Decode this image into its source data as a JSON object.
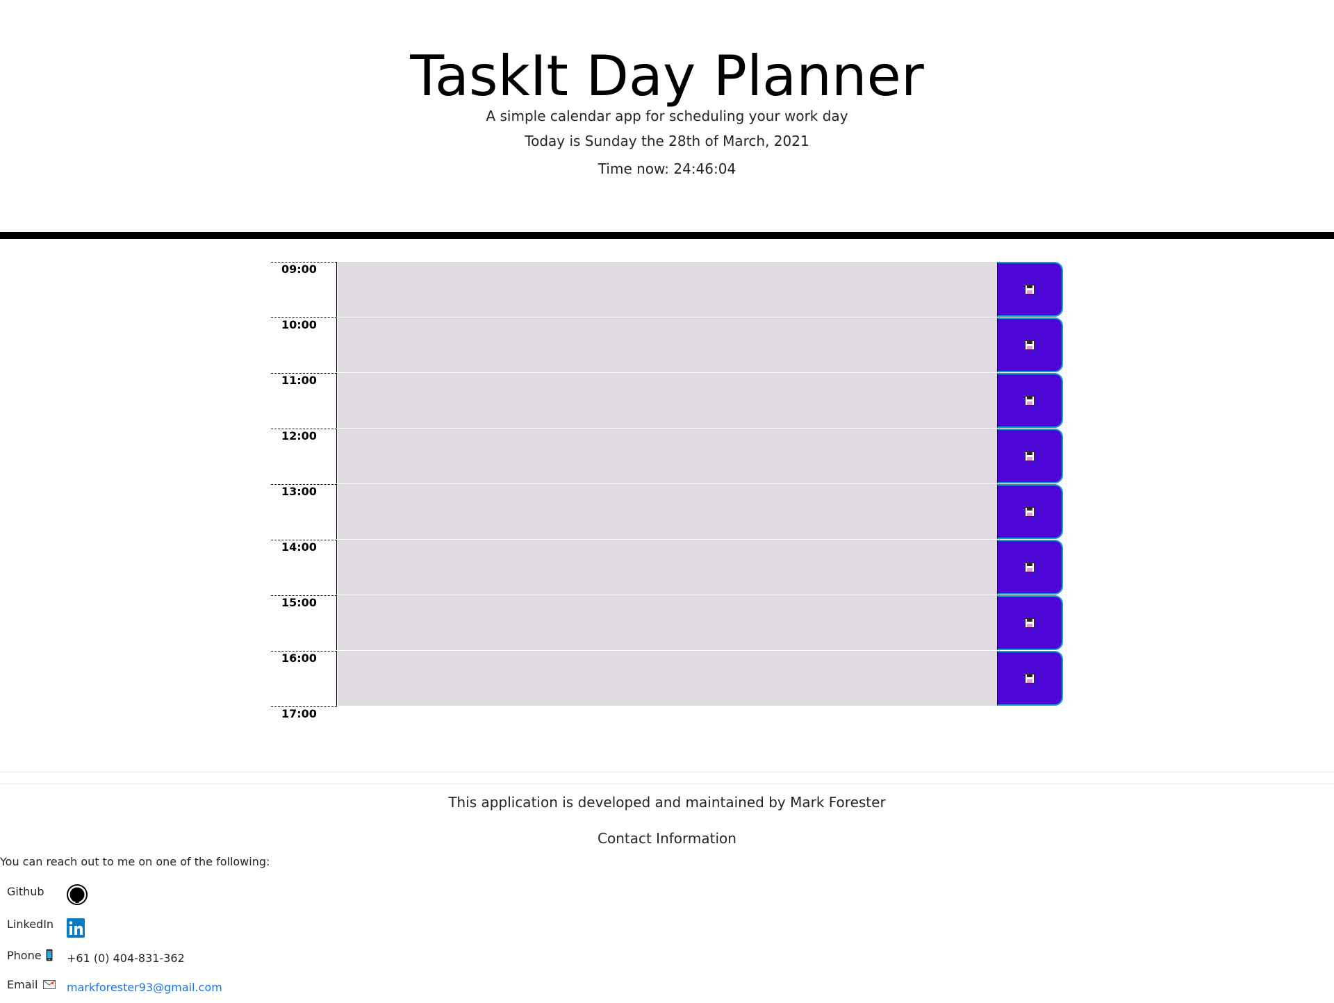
{
  "header": {
    "title": "TaskIt Day Planner",
    "subtitle": "A simple calendar app for scheduling your work day",
    "today": "Today is Sunday the 28th of March, 2021",
    "time_now": "Time now: 24:46:04"
  },
  "planner": {
    "hours": [
      "09:00",
      "10:00",
      "11:00",
      "12:00",
      "13:00",
      "14:00",
      "15:00",
      "16:00"
    ],
    "end_hour": "17:00",
    "tasks": [
      "",
      "",
      "",
      "",
      "",
      "",
      "",
      ""
    ],
    "save_icon": "floppy-disk-icon",
    "colors": {
      "task_background": "#e0dbe1",
      "save_button": "#4e06d6",
      "save_button_border": "#12a0d8"
    }
  },
  "footer": {
    "developer_note": "This application is developed and maintained by Mark Forester",
    "contact_heading": "Contact Information",
    "reach_out": "You can reach out to me on one of the following:",
    "contacts": [
      {
        "label": "Github",
        "icon": "github-icon",
        "value": ""
      },
      {
        "label": "LinkedIn",
        "icon": "linkedin-icon",
        "value": ""
      },
      {
        "label": "Phone",
        "icon": "mobile-phone-icon",
        "value": "+61 (0) 404-831-362"
      },
      {
        "label": "Email",
        "icon": "envelope-icon",
        "value": "markforester93@gmail.com"
      }
    ]
  }
}
